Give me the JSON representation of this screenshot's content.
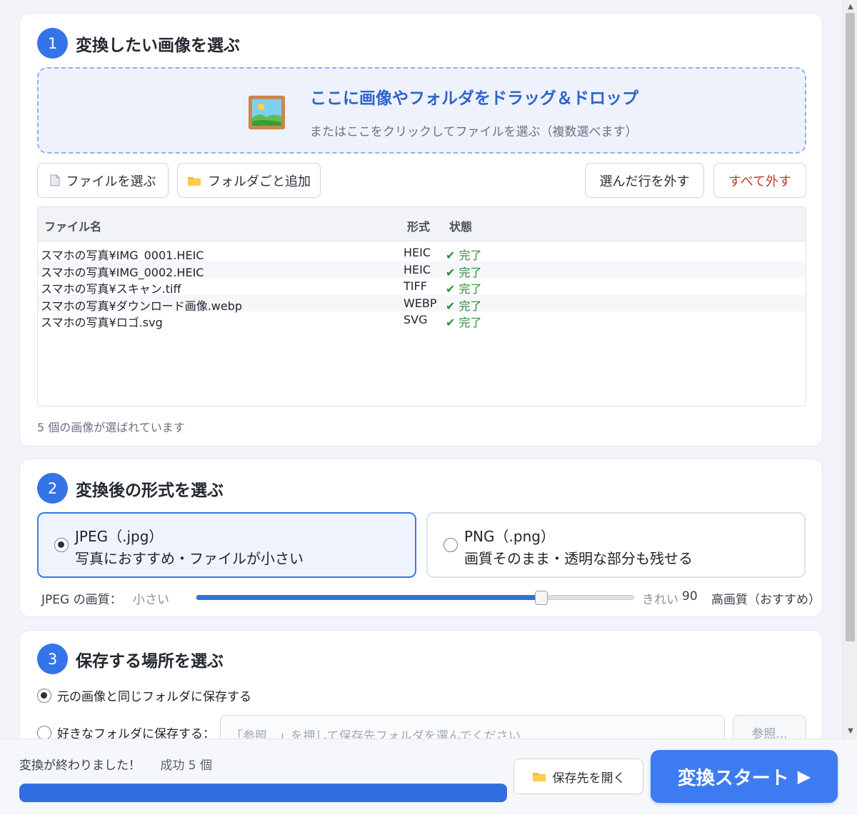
{
  "step1": {
    "number": "1",
    "title": "変換したい画像を選ぶ",
    "dropzone": {
      "icon": "picture-icon",
      "title": "ここに画像やフォルダをドラッグ＆ドロップ",
      "subtitle": "またはここをクリックしてファイルを選ぶ（複数選べます）"
    },
    "buttons": {
      "choose_files": "ファイルを選ぶ",
      "add_folder": "フォルダごと追加",
      "remove_selected": "選んだ行を外す",
      "remove_all": "すべて外す"
    },
    "table": {
      "headers": {
        "name": "ファイル名",
        "format": "形式",
        "status": "状態"
      },
      "rows": [
        {
          "name": "スマホの写真¥IMG_0001.HEIC",
          "format": "HEIC",
          "status": "✔ 完了"
        },
        {
          "name": "スマホの写真¥IMG_0002.HEIC",
          "format": "HEIC",
          "status": "✔ 完了"
        },
        {
          "name": "スマホの写真¥スキャン.tiff",
          "format": "TIFF",
          "status": "✔ 完了"
        },
        {
          "name": "スマホの写真¥ダウンロード画像.webp",
          "format": "WEBP",
          "status": "✔ 完了"
        },
        {
          "name": "スマホの写真¥ロゴ.svg",
          "format": "SVG",
          "status": "✔ 完了"
        }
      ]
    },
    "count_text": "5 個の画像が選ばれています"
  },
  "step2": {
    "number": "2",
    "title": "変換後の形式を選ぶ",
    "options": [
      {
        "title": "JPEG（.jpg）",
        "desc": "写真におすすめ・ファイルが小さい",
        "selected": true
      },
      {
        "title": "PNG（.png）",
        "desc": "画質そのまま・透明な部分も残せる",
        "selected": false
      }
    ],
    "quality": {
      "label": "JPEG の画質：",
      "min_label": "小さい",
      "max_label": "きれい",
      "value": "90",
      "value_fraction": 0.79,
      "hint": "高画質（おすすめ）"
    }
  },
  "step3": {
    "number": "3",
    "title": "保存する場所を選ぶ",
    "options": {
      "same_folder": "元の画像と同じフォルダに保存する",
      "custom_folder": "好きなフォルダに保存する："
    },
    "path_placeholder": "「参照...」を押して保存先フォルダを選んでください",
    "browse": "参照..."
  },
  "bottom": {
    "status": "変換が終わりました！",
    "success": "成功 5 個",
    "progress_percent": 100,
    "open_folder": "保存先を開く",
    "start": "変換スタート"
  },
  "colors": {
    "accent": "#3474e8",
    "success": "#2e8b3e",
    "danger": "#c0392b"
  }
}
